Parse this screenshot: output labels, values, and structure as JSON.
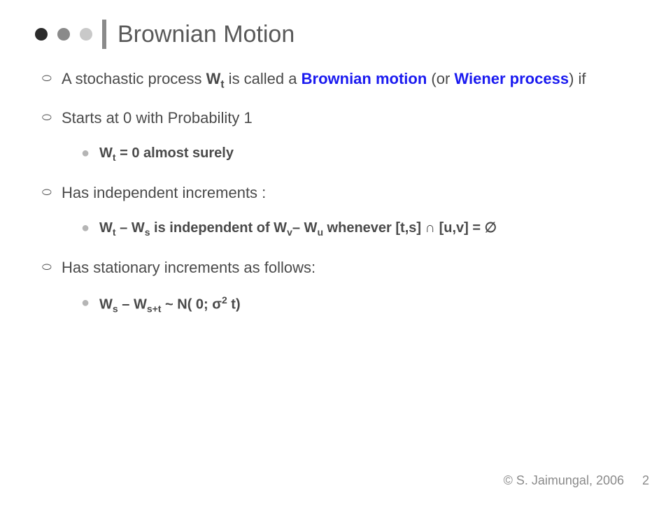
{
  "header": {
    "title": "Brownian Motion"
  },
  "bullets": {
    "b1_pre": "A stochastic process ",
    "b1_wt": "W",
    "b1_wt_sub": "t",
    "b1_mid": " is called a ",
    "b1_term1": "Brownian motion",
    "b1_or": " (or ",
    "b1_term2": "Wiener process",
    "b1_post": ") if",
    "b2": "Starts at 0 with Probability 1",
    "b2_sub_pre": "W",
    "b2_sub_sub": "t",
    "b2_sub_post": " = 0 almost surely",
    "b3": "Has independent increments :",
    "b3_sub_w1": "W",
    "b3_sub_s1": "t",
    "b3_sub_m1": " – ",
    "b3_sub_w2": "W",
    "b3_sub_s2": "s",
    "b3_sub_mid": " is independent of ",
    "b3_sub_w3": "W",
    "b3_sub_s3": "v",
    "b3_sub_m2": "– ",
    "b3_sub_w4": "W",
    "b3_sub_s4": "u",
    "b3_sub_when": " whenever [t,s] ∩ [u,v] = ∅",
    "b4": "Has stationary increments as follows:",
    "b4_sub_w1": "W",
    "b4_sub_s1": "s",
    "b4_sub_m1": " – ",
    "b4_sub_w2": "W",
    "b4_sub_s2": "s+t",
    "b4_sub_tilde": " ~ N( 0; σ",
    "b4_sub_sup": "2",
    "b4_sub_end": " t)"
  },
  "footer": {
    "copyright": "© S. Jaimungal, 2006",
    "page": "2"
  }
}
